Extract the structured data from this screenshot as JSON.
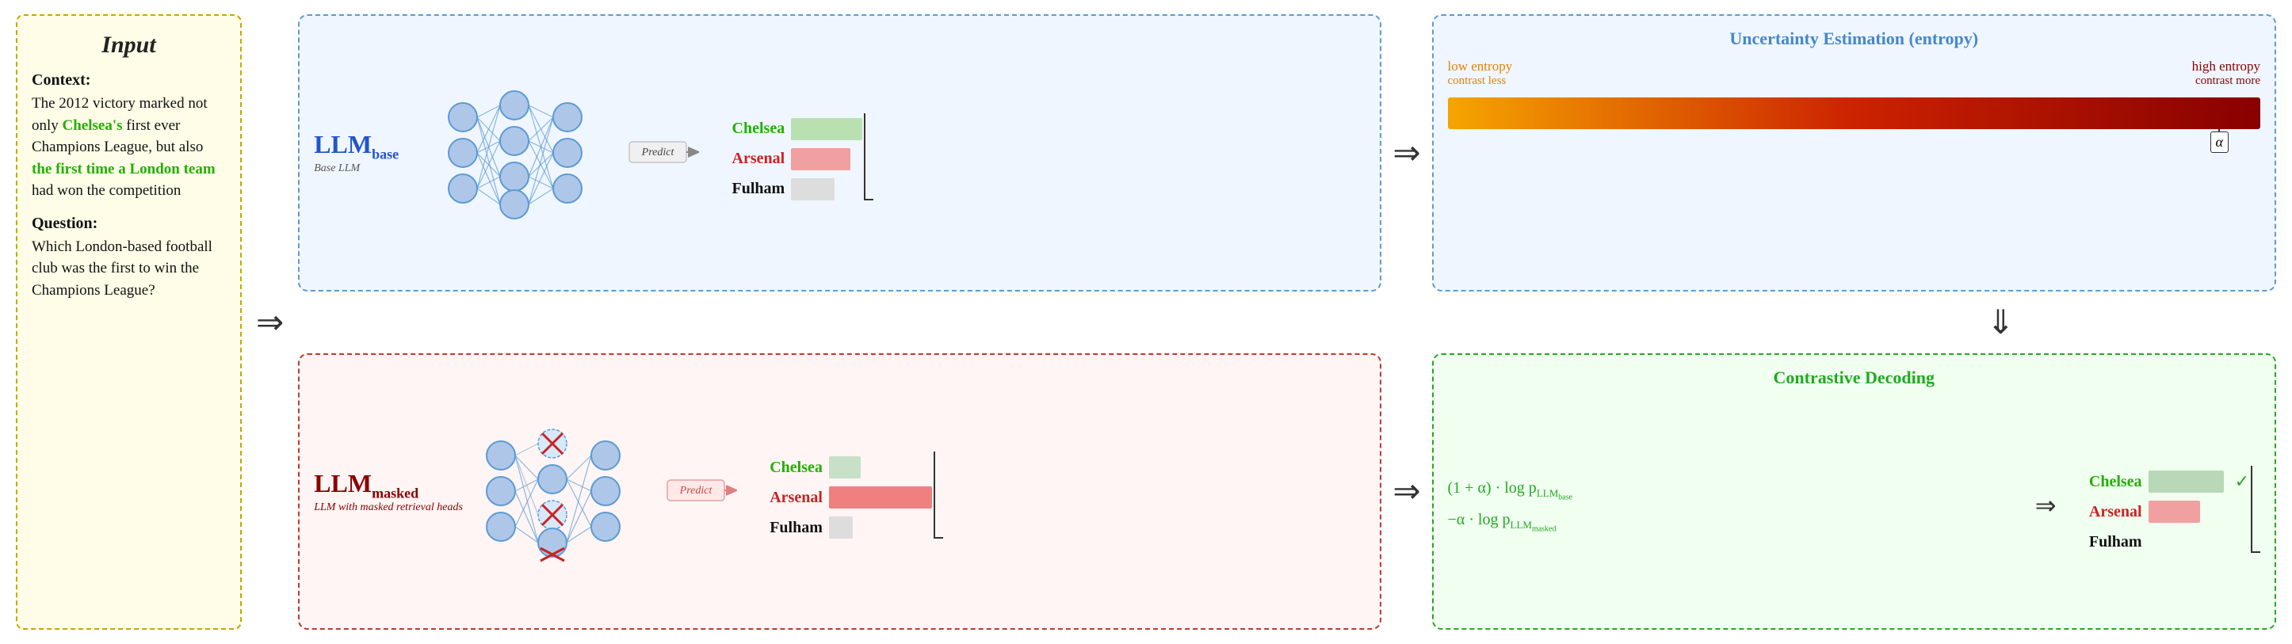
{
  "input": {
    "title": "Input",
    "context_label": "Context:",
    "context_text_1": "The 2012 victory marked not only ",
    "context_chelsea": "Chelsea's",
    "context_text_2": " first ever Champions League, but also ",
    "context_london": "the first time a London team",
    "context_text_3": " had won the competition",
    "question_label": "Question:",
    "question_text": "Which London-based football club was the first to win the Champions League?"
  },
  "llm_base": {
    "name": "LLM",
    "subscript": "base",
    "sublabel": "Base LLM"
  },
  "llm_masked": {
    "name": "LLM",
    "subscript": "masked",
    "sublabel": "LLM with masked retrieval heads"
  },
  "predict_top": "Predict",
  "predict_bottom": "Predict",
  "bars_base": {
    "chelsea_label": "Chelsea",
    "arsenal_label": "Arsenal",
    "fulham_label": "Fulham"
  },
  "bars_masked": {
    "chelsea_label": "Chelsea",
    "arsenal_label": "Arsenal",
    "fulham_label": "Fulham"
  },
  "uncertainty": {
    "title": "Uncertainty Estimation (entropy)",
    "low_entropy": "low entropy",
    "contrast_less": "contrast less",
    "high_entropy": "high entropy",
    "contrast_more": "contrast more",
    "alpha_label": "α"
  },
  "contrastive": {
    "title": "Contrastive Decoding",
    "formula_line1": "(1 + α) · log p",
    "formula_llm_base": "LLM",
    "formula_base_sub": "base",
    "formula_line2": "−α · log p",
    "formula_llm_masked": "LLM",
    "formula_masked_sub": "masked",
    "chelsea_label": "Chelsea",
    "arsenal_label": "Arsenal",
    "fulham_label": "Fulham"
  }
}
